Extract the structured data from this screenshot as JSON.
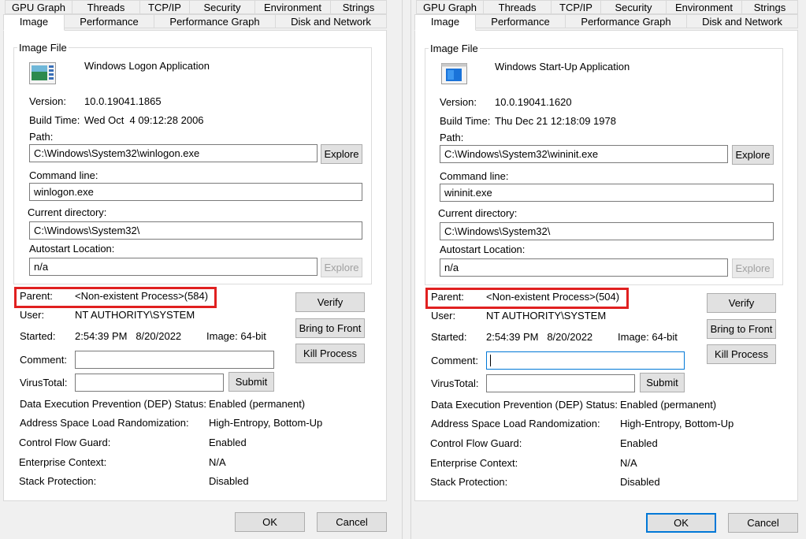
{
  "tabs_row1": [
    "GPU Graph",
    "Threads",
    "TCP/IP",
    "Security",
    "Environment",
    "Strings"
  ],
  "tabs_row2": [
    "Image",
    "Performance",
    "Performance Graph",
    "Disk and Network"
  ],
  "labels": {
    "image_file": "Image File",
    "version": "Version:",
    "build_time": "Build Time:",
    "path": "Path:",
    "command_line": "Command line:",
    "current_directory": "Current directory:",
    "autostart_location": "Autostart Location:",
    "parent": "Parent:",
    "user": "User:",
    "started": "Started:",
    "comment": "Comment:",
    "virustotal": "VirusTotal:",
    "dep": "Data Execution Prevention (DEP) Status:",
    "aslr": "Address Space Load Randomization:",
    "cfg": "Control Flow Guard:",
    "enterprise": "Enterprise Context:",
    "stack": "Stack Protection:"
  },
  "buttons": {
    "explore": "Explore",
    "verify": "Verify",
    "bring_to_front": "Bring to Front",
    "kill_process": "Kill Process",
    "submit": "Submit",
    "ok": "OK",
    "cancel": "Cancel"
  },
  "left": {
    "description": "Windows Logon Application",
    "version": "10.0.19041.1865",
    "build_time": "Wed Oct  4 09:12:28 2006",
    "path": "C:\\Windows\\System32\\winlogon.exe",
    "command_line": "winlogon.exe",
    "current_directory": "C:\\Windows\\System32\\",
    "autostart_location": "n/a",
    "parent": "<Non-existent Process>(584)",
    "user": "NT AUTHORITY\\SYSTEM",
    "started": "2:54:39 PM   8/20/2022",
    "image_bits": "Image: 64-bit",
    "comment": "",
    "virustotal": "",
    "dep": "Enabled (permanent)",
    "aslr": "High-Entropy, Bottom-Up",
    "cfg": "Enabled",
    "enterprise": "N/A",
    "stack": "Disabled"
  },
  "right": {
    "description": "Windows Start-Up Application",
    "version": "10.0.19041.1620",
    "build_time": "Thu Dec 21 12:18:09 1978",
    "path": "C:\\Windows\\System32\\wininit.exe",
    "command_line": "wininit.exe",
    "current_directory": "C:\\Windows\\System32\\",
    "autostart_location": "n/a",
    "parent": "<Non-existent Process>(504)",
    "user": "NT AUTHORITY\\SYSTEM",
    "started": "2:54:39 PM   8/20/2022",
    "image_bits": "Image: 64-bit",
    "comment": "",
    "virustotal": "",
    "dep": "Enabled (permanent)",
    "aslr": "High-Entropy, Bottom-Up",
    "cfg": "Enabled",
    "enterprise": "N/A",
    "stack": "Disabled"
  },
  "icons": {
    "left": "winlogon-app-icon",
    "right": "wininit-app-icon"
  },
  "colors": {
    "highlight_box": "#e02020",
    "focus": "#0078d7"
  }
}
